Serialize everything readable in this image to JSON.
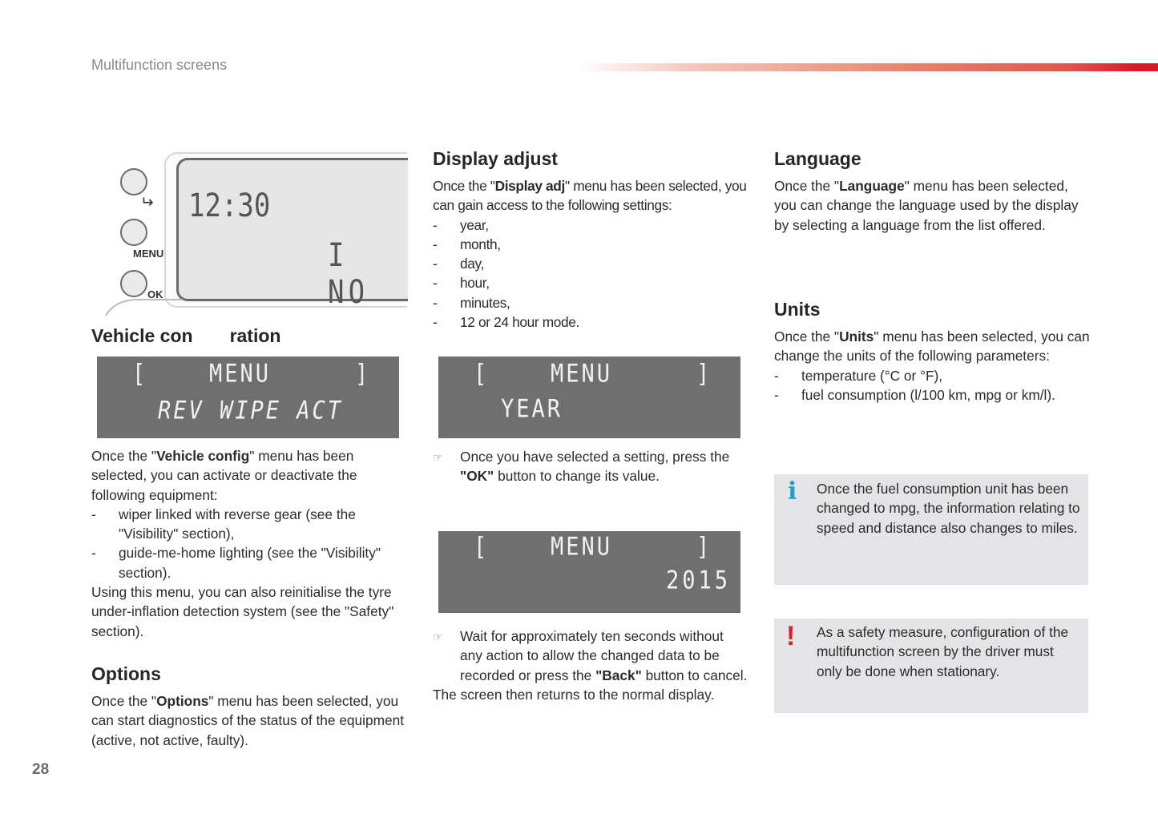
{
  "header": {
    "section_title": "Multifunction screens",
    "accent_color": "#d7192a"
  },
  "page_number": "28",
  "device_illustration": {
    "clock": "12:30",
    "second_line": "I NO",
    "buttons": [
      {
        "icon": "back-arrow-icon",
        "label": "⮌"
      },
      {
        "label": "MENU"
      },
      {
        "label": "OK"
      }
    ]
  },
  "vehicle_config": {
    "heading_part1": "Vehicle con",
    "heading_part2": "ration",
    "lcd": {
      "bracket_left": "[",
      "title": "MENU",
      "bracket_right": "]",
      "line2": "REV WIPE ACT"
    },
    "intro_pre": "Once the \"",
    "intro_bold": "Vehicle config",
    "intro_post": "\" menu has been selected, you can activate or deactivate the following equipment:",
    "items": [
      "wiper linked with reverse gear (see the \"Visibility\" section),",
      "guide-me-home lighting (see the \"Visibility\" section)."
    ],
    "outro": "Using this menu, you can also reinitialise the tyre under-inflation detection system (see the \"Safety\" section)."
  },
  "options": {
    "heading": "Options",
    "text_pre": "Once the \"",
    "text_bold": "Options",
    "text_post": "\" menu has been selected, you can start diagnostics of the status of the equipment (active, not active, faulty)."
  },
  "display_adjust": {
    "heading": "Display adjust",
    "intro_pre": "Once the \"",
    "intro_bold": "Display adj",
    "intro_post": "\" menu has been selected, you can gain access to the following settings:",
    "items": [
      "year,",
      "month,",
      "day,",
      "hour,",
      "minutes,",
      "12 or 24 hour mode."
    ],
    "lcd1": {
      "bracket_left": "[",
      "title": "MENU",
      "bracket_right": "]",
      "line2": "YEAR"
    },
    "note1_pre": "Once you have selected a setting, press the ",
    "note1_bold": "\"OK\"",
    "note1_post": " button to change its value.",
    "lcd2": {
      "bracket_left": "[",
      "title": "MENU",
      "bracket_right": "]",
      "line2": "2015"
    },
    "note2_pre": "Wait for approximately ten seconds without any action to allow the changed data to be recorded or press the ",
    "note2_bold": "\"Back\"",
    "note2_post": " button to cancel.",
    "outro": "The screen then returns to the normal display.",
    "note_icon": "☞"
  },
  "language": {
    "heading": "Language",
    "text_pre": "Once the \"",
    "text_bold": "Language",
    "text_post": "\" menu has been selected, you can change the language used by the display by selecting a language from the list offered."
  },
  "units": {
    "heading": "Units",
    "intro_pre": "Once the \"",
    "intro_bold": "Units",
    "intro_post": "\" menu has been selected, you can change the units of the following parameters:",
    "items": [
      "temperature (°C or °F),",
      "fuel consumption (l/100 km, mpg or km/l)."
    ]
  },
  "info_box": {
    "icon": "i",
    "icon_color": "#1ea0cf",
    "text": "Once the fuel consumption unit has been changed to mpg, the information relating to speed and distance also changes to miles."
  },
  "warning_box": {
    "icon": "!",
    "icon_color": "#d9202e",
    "text": "As a safety measure, configuration of the multifunction screen by the driver must only be done when stationary."
  }
}
